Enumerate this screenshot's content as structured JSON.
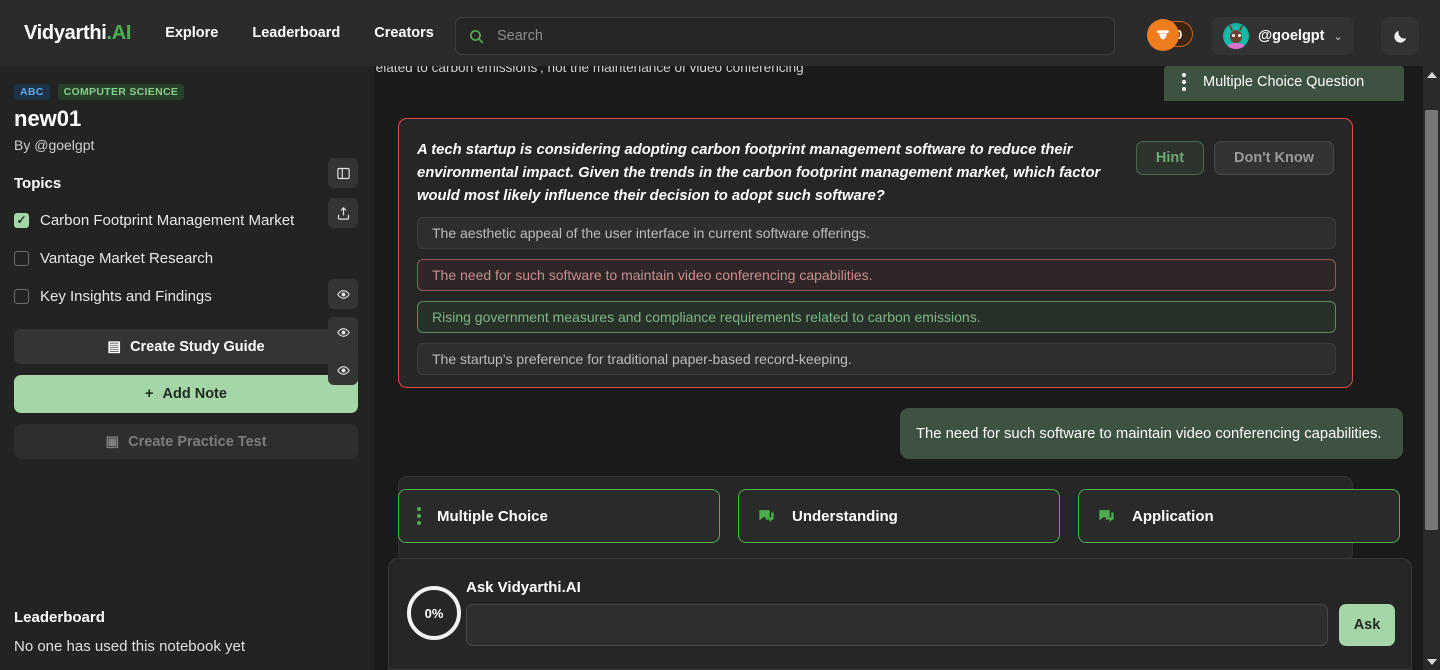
{
  "header": {
    "logo_main": "Vidyarthi",
    "logo_suffix": ".AI",
    "nav": [
      {
        "label": "Explore"
      },
      {
        "label": "Leaderboard"
      },
      {
        "label": "Creators"
      }
    ],
    "search": {
      "placeholder": "Search",
      "value": "",
      "icon": "search-icon"
    },
    "acorn": {
      "count": "0",
      "icon": "acorn-icon"
    },
    "user": {
      "name": "@goelgpt",
      "chevron": "⌄",
      "avatar_icon": "avatar-character"
    },
    "theme_toggle": {
      "icon": "moon-icon",
      "glyph": "🌙"
    }
  },
  "sidebar": {
    "badges": [
      {
        "label": "ABC",
        "color": "#64a8e0"
      },
      {
        "label": "COMPUTER SCIENCE",
        "color": "#85cc8a"
      }
    ],
    "notebook_title": "new01",
    "author_prefix": "By ",
    "author": "@goelgpt",
    "panel_icon": "panel-layout-icon",
    "share_icon": "share-icon",
    "topics_label": "Topics",
    "topics": [
      {
        "label": "Carbon Footprint Management Market",
        "checked": true,
        "eye_icon": "eye-icon"
      },
      {
        "label": "Vantage Market Research",
        "checked": false,
        "eye_icon": "eye-icon"
      },
      {
        "label": "Key Insights and Findings",
        "checked": false,
        "eye_icon": "eye-icon"
      }
    ],
    "actions": {
      "study_guide": {
        "label": "Create Study Guide",
        "icon": "document-icon",
        "glyph": "▤"
      },
      "add_note": {
        "label": "Add Note",
        "icon": "plus-icon",
        "glyph": "+"
      },
      "practice_test": {
        "label": "Create Practice Test",
        "icon": "test-book-icon",
        "glyph": "▣",
        "disabled": true
      }
    },
    "leaderboard": {
      "title": "Leaderboard",
      "empty_text": "No one has used this notebook yet"
    }
  },
  "main": {
    "question_type_chip": {
      "label": "Multiple Choice Question",
      "icon": "kebab-menu-icon"
    },
    "question": {
      "text": "A tech startup is considering adopting carbon footprint management software to reduce their environmental impact. Given the trends in the carbon footprint management market, which factor would most likely influence their decision to adopt such software?",
      "hint_button": "Hint",
      "dont_know_button": "Don't Know",
      "border_color": "#e04c4c"
    },
    "options": [
      {
        "text": "The aesthetic appeal of the user interface in current software offerings.",
        "state": "neutral"
      },
      {
        "text": "The need for such software to maintain video conferencing capabilities.",
        "state": "wrong"
      },
      {
        "text": "Rising government measures and compliance requirements related to carbon emissions.",
        "state": "correct"
      },
      {
        "text": "The startup's preference for traditional paper-based record-keeping.",
        "state": "neutral"
      }
    ],
    "chat_answer": "The need for such software to maintain video conferencing capabilities.",
    "feedback_text": "government measures and compliance requirements related to carbon emissions', not the maintenance of video conferencing",
    "warn_icon": "warning-icon",
    "tabs": [
      {
        "label": "Multiple Choice",
        "icon": "kebab-menu-icon",
        "icon_kind": "kebab"
      },
      {
        "label": "Understanding",
        "icon": "chat-bubble-icon",
        "icon_kind": "chat"
      },
      {
        "label": "Application",
        "icon": "chat-bubble-icon",
        "icon_kind": "chat"
      }
    ]
  },
  "ask": {
    "progress_label": "0%",
    "title": "Ask Vidyarthi.AI",
    "input_value": "",
    "input_placeholder": "",
    "button_label": "Ask"
  },
  "colors": {
    "accent_green": "#4caf50",
    "light_green": "#a5d6a7",
    "error_red": "#e04c4c",
    "bg_dark": "#1a1a1a",
    "panel": "#262626"
  }
}
